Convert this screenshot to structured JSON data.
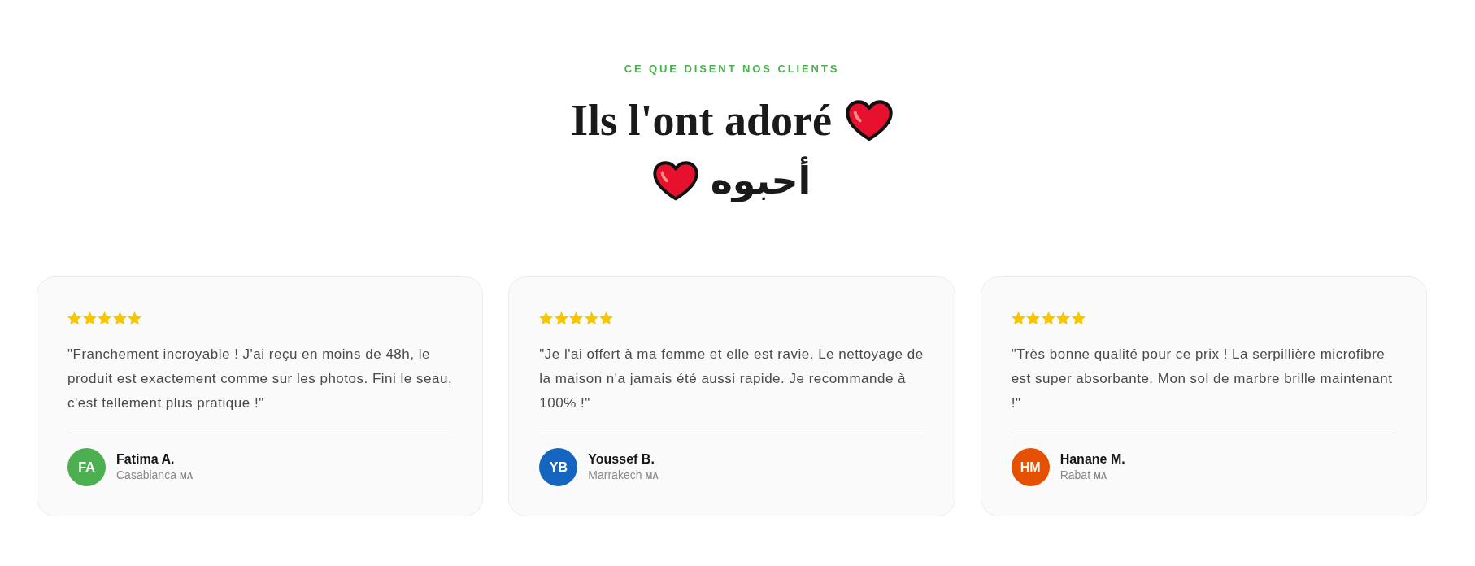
{
  "section": {
    "eyebrow": "CE QUE DISENT NOS CLIENTS",
    "title": "Ils l'ont adoré",
    "title_arabic": "أحبوه"
  },
  "reviews": [
    {
      "stars": 5,
      "quote": "\"Franchement incroyable ! J'ai reçu en moins de 48h, le produit est exactement comme sur les photos. Fini le seau, c'est tellement plus pratique !\"",
      "initials": "FA",
      "color": "#4caf50",
      "name": "Fatima A.",
      "city": "Casablanca",
      "country": "MA"
    },
    {
      "stars": 5,
      "quote": "\"Je l'ai offert à ma femme et elle est ravie. Le nettoyage de la maison n'a jamais été aussi rapide. Je recommande à 100% !\"",
      "initials": "YB",
      "color": "#1565c0",
      "name": "Youssef B.",
      "city": "Marrakech",
      "country": "MA"
    },
    {
      "stars": 5,
      "quote": "\"Très bonne qualité pour ce prix ! La serpillière microfibre est super absorbante. Mon sol de marbre brille maintenant !\"",
      "initials": "HM",
      "color": "#e65100",
      "name": "Hanane M.",
      "city": "Rabat",
      "country": "MA"
    }
  ]
}
